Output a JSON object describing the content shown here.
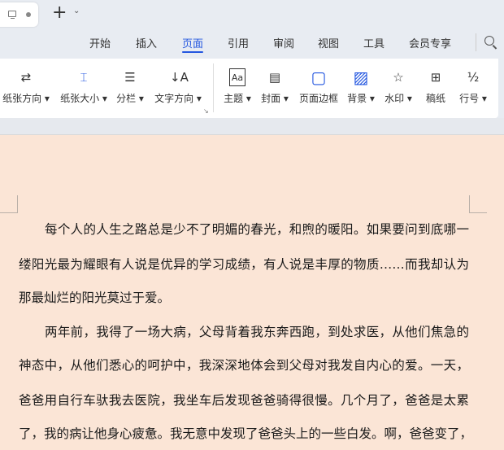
{
  "titlebar": {
    "new_tab_label": "+",
    "tab_icons": [
      "monitor-icon",
      "unsaved-dot-icon"
    ]
  },
  "menu": {
    "tabs": [
      {
        "label": "开始"
      },
      {
        "label": "插入"
      },
      {
        "label": "页面",
        "active": true
      },
      {
        "label": "引用"
      },
      {
        "label": "审阅"
      },
      {
        "label": "视图"
      },
      {
        "label": "工具"
      },
      {
        "label": "会员专享"
      }
    ]
  },
  "ribbon": {
    "items": [
      {
        "label": "纸张方向 ▾",
        "icon": "⇄"
      },
      {
        "label": "纸张大小 ▾",
        "icon": "⌶"
      },
      {
        "label": "分栏 ▾",
        "icon": "☰"
      },
      {
        "label": "文字方向 ▾",
        "icon": "↓A"
      },
      {
        "label": "主题 ▾",
        "icon": "Aa"
      },
      {
        "label": "封面 ▾",
        "icon": "▤"
      },
      {
        "label": "页面边框",
        "icon": "▢"
      },
      {
        "label": "背景 ▾",
        "icon": "▨"
      },
      {
        "label": "水印 ▾",
        "icon": "☆"
      },
      {
        "label": "稿纸",
        "icon": "⊞"
      },
      {
        "label": "行号 ▾",
        "icon": "½"
      }
    ]
  },
  "colors": {
    "accent": "#2457e0",
    "page": "#fbe5d6"
  },
  "document": {
    "lines": [
      "每个人的人生之路总是少不了明媚的春光，和煦的暖阳。如果要问到底哪一",
      "缕阳光最为耀眼有人说是优异的学习成绩，有人说是丰厚的物质……而我却认为",
      "那最灿烂的阳光莫过于爱。",
      "两年前，我得了一场大病，父母背着我东奔西跑，到处求医，从他们焦急的",
      "神态中，从他们悉心的呵护中，我深深地体会到父母对我发自内心的爱。一天，",
      "爸爸用自行车驮我去医院，我坐车后发现爸爸骑得很慢。几个月了，爸爸是太累",
      "了，我的病让他身心疲惫。我无意中发现了爸爸头上的一些白发。啊，爸爸变了，"
    ]
  }
}
